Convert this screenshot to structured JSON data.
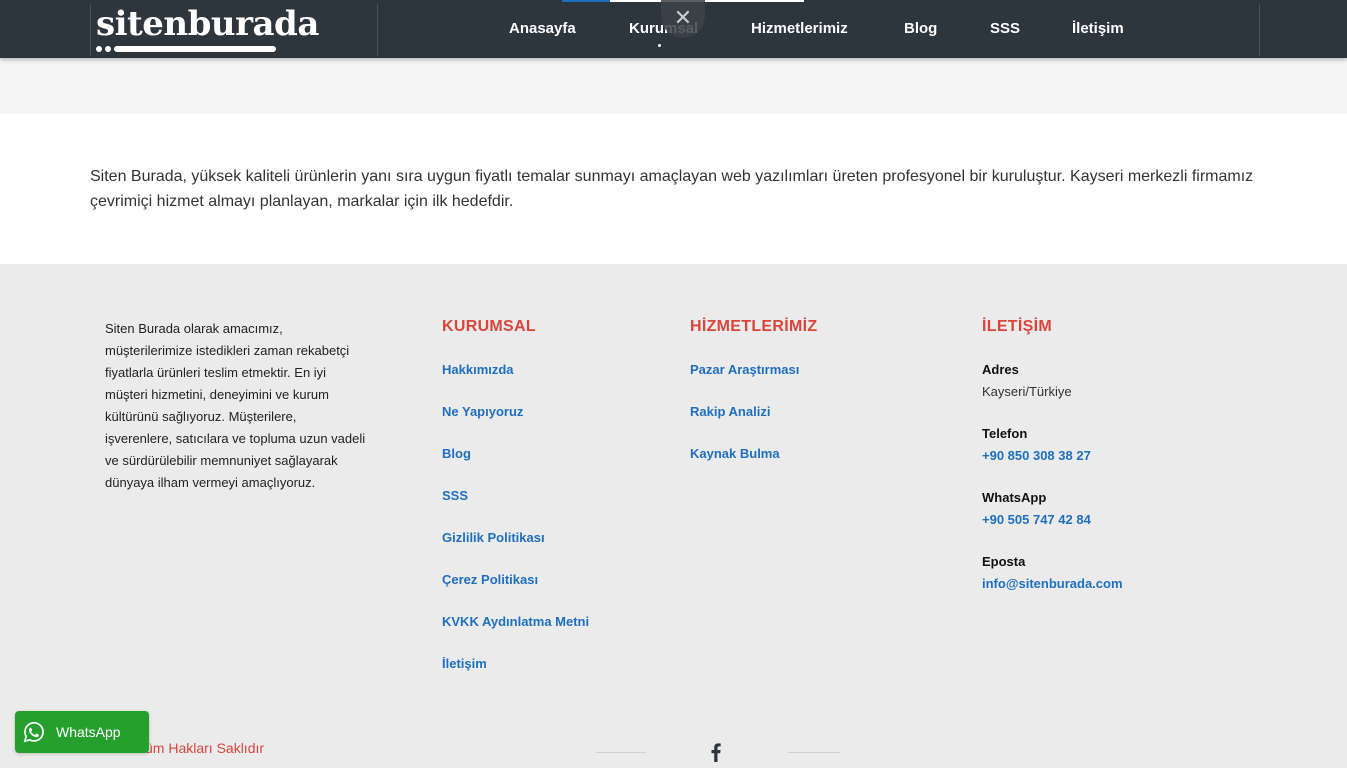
{
  "header": {
    "logo_text": "sitenburada",
    "nav": [
      "Anasayfa",
      "Kurumsal",
      "Hizmetlerimiz",
      "Blog",
      "SSS",
      "İletişim"
    ],
    "close_symbol": "✕"
  },
  "intro": {
    "text": "Siten Burada, yüksek kaliteli ürünlerin yanı sıra uygun fiyatlı temalar sunmayı amaçlayan web yazılımları üreten profesyonel bir kuruluştur. Kayseri merkezli firmamız çevrimiçi hizmet almayı planlayan, markalar için ilk hedefdir."
  },
  "footer": {
    "about": "Siten Burada olarak amacımız, müşterilerimize istedikleri zaman rekabetçi fiyatlarla ürünleri teslim etmektir. En iyi müşteri hizmetini, deneyimini ve kurum kültürünü sağlıyoruz. Müşterilere, işverenlere, satıcılara ve topluma uzun vadeli ve sürdürülebilir memnuniyet sağlayarak dünyaya ilham vermeyi amaçlıyoruz.",
    "kurumsal": {
      "title": "KURUMSAL",
      "links": [
        "Hakkımızda",
        "Ne Yapıyoruz",
        "Blog",
        "SSS",
        "Gizlilik Politikası",
        "Çerez Politikası",
        "KVKK Aydınlatma Metni",
        "İletişim"
      ]
    },
    "hizmetler": {
      "title": "HİZMETLERİMİZ",
      "links": [
        "Pazar Araştırması",
        "Rakip Analizi",
        "Kaynak Bulma"
      ]
    },
    "iletisim": {
      "title": "İLETİŞİM",
      "adres_label": "Adres",
      "adres_value": "Kayseri/Türkiye",
      "telefon_label": "Telefon",
      "telefon_value": "+90 850 308 38 27",
      "whatsapp_label": "WhatsApp",
      "whatsapp_value": "+90 505 747 42 84",
      "eposta_label": "Eposta",
      "eposta_value": "info@sitenburada.com"
    },
    "copyright": "üm Hakları Saklıdır"
  },
  "whatsapp_button": {
    "label": "WhatsApp"
  },
  "colors": {
    "header_bg": "#2d353d",
    "accent_red": "#d9453a",
    "link_blue": "#1e6fc0",
    "whatsapp_green": "#25a02f",
    "footer_bg": "#ebebeb"
  },
  "icons": [
    "close-icon",
    "facebook-icon",
    "whatsapp-icon"
  ]
}
